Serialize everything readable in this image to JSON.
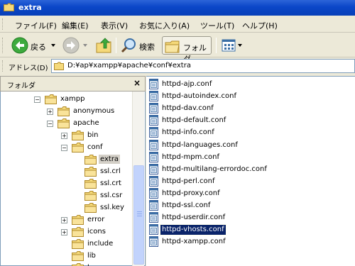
{
  "window": {
    "title": "extra"
  },
  "menu": {
    "items": [
      "ファイル(F)",
      "編集(E)",
      "表示(V)",
      "お気に入り(A)",
      "ツール(T)",
      "ヘルプ(H)"
    ]
  },
  "toolbar": {
    "back_label": "戻る",
    "search_label": "検索",
    "folders_label": "フォルダ"
  },
  "address": {
    "label": "アドレス(D)",
    "value": "D:¥ap¥xampp¥apache¥conf¥extra"
  },
  "folder_pane": {
    "title": "フォルダ",
    "close": "×"
  },
  "tree": [
    {
      "label": "xampp",
      "expander": "−"
    },
    {
      "label": "anonymous",
      "expander": "+"
    },
    {
      "label": "apache",
      "expander": "−"
    },
    {
      "label": "bin",
      "expander": "+"
    },
    {
      "label": "conf",
      "expander": "−"
    },
    {
      "label": "extra",
      "expander": ""
    },
    {
      "label": "ssl.crl",
      "expander": ""
    },
    {
      "label": "ssl.crt",
      "expander": ""
    },
    {
      "label": "ssl.csr",
      "expander": ""
    },
    {
      "label": "ssl.key",
      "expander": ""
    },
    {
      "label": "error",
      "expander": "+"
    },
    {
      "label": "icons",
      "expander": "+"
    },
    {
      "label": "include",
      "expander": ""
    },
    {
      "label": "lib",
      "expander": ""
    },
    {
      "label": "l",
      "expander": ""
    }
  ],
  "files": [
    "httpd-ajp.conf",
    "httpd-autoindex.conf",
    "httpd-dav.conf",
    "httpd-default.conf",
    "httpd-info.conf",
    "httpd-languages.conf",
    "httpd-mpm.conf",
    "httpd-multilang-errordoc.conf",
    "httpd-perl.conf",
    "httpd-proxy.conf",
    "httpd-ssl.conf",
    "httpd-userdir.conf",
    "httpd-vhosts.conf",
    "httpd-xampp.conf"
  ],
  "selected_file": "httpd-vhosts.conf",
  "colors": {
    "titlebar": "#0A46C8",
    "selection": "#0A246A",
    "folder": "#F5D97A"
  }
}
